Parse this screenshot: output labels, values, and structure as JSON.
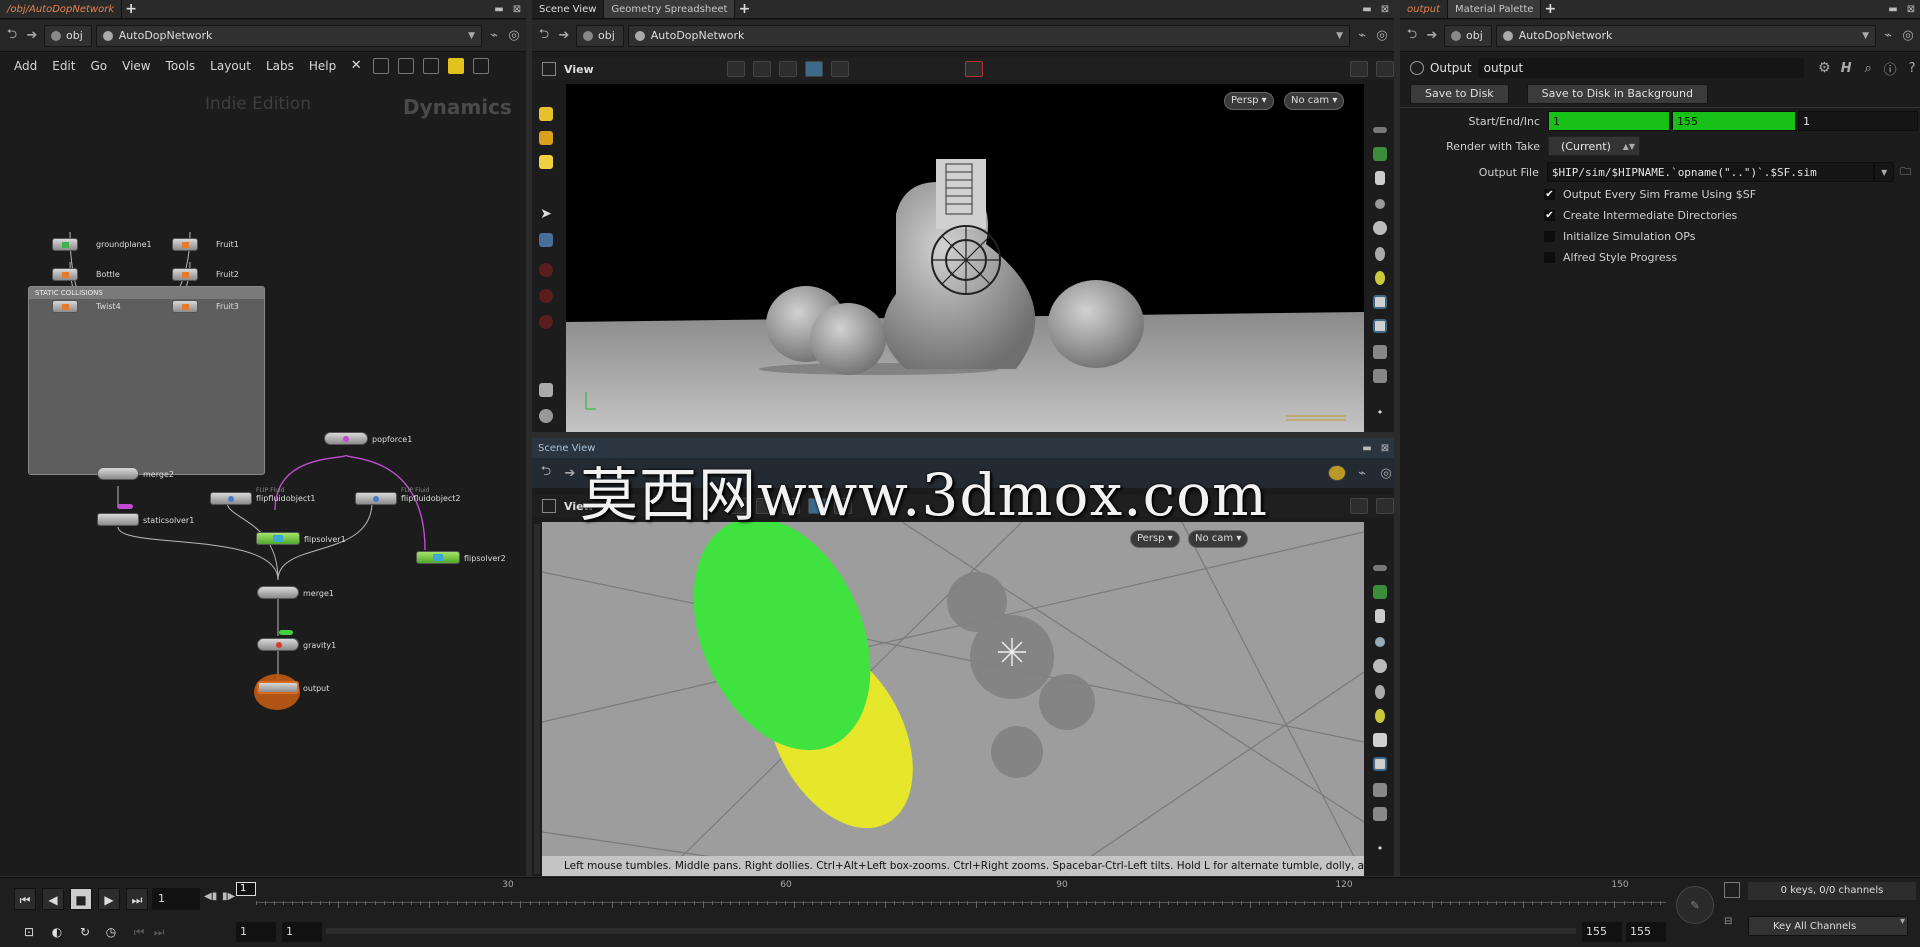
{
  "left": {
    "tab_path": "/obj/AutoDopNetwork",
    "path_obj": "obj",
    "path_net": "AutoDopNetwork",
    "menus": [
      "Add",
      "Edit",
      "Go",
      "View",
      "Tools",
      "Layout",
      "Labs",
      "Help"
    ],
    "edition": "Indie Edition",
    "context": "Dynamics",
    "netbox_title": "STATIC COLLISIONS",
    "nodes": {
      "groundplane1": "groundplane1",
      "bottle": "Bottle",
      "twist4": "Twist4",
      "fruit1": "Fruit1",
      "fruit2": "Fruit2",
      "fruit3": "Fruit3",
      "merge2": "merge2",
      "staticsolver1": "staticsolver1",
      "popforce1": "popforce1",
      "flipfluidobject1": "flipfluidobject1",
      "flipfluidobject2": "flipfluidobject2",
      "flip_fluid_sub": "FLIP Fluid",
      "flipsolver1": "flipsolver1",
      "flipsolver2": "flipsolver2",
      "merge1": "merge1",
      "gravity1": "gravity1",
      "output": "output"
    }
  },
  "middle": {
    "tabs": [
      "Scene View",
      "Geometry Spreadsheet"
    ],
    "path_obj": "obj",
    "path_net": "AutoDopNetwork",
    "view_label": "View",
    "persp": "Persp",
    "cam": "No cam",
    "lower_tab": "Scene View",
    "lower_view_label": "View",
    "lower_persp": "Persp",
    "lower_cam": "No cam",
    "status": "Left mouse tumbles. Middle pans. Right dollies. Ctrl+Alt+Left box-zooms. Ctrl+Right zooms. Spacebar-Ctrl-Left tilts. Hold L for alternate tumble, dolly, and zoom."
  },
  "right": {
    "tabs": [
      "output",
      "Material Palette"
    ],
    "path_obj": "obj",
    "path_net": "AutoDopNetwork",
    "node_type": "Output",
    "node_name": "output",
    "save_to_disk": "Save to Disk",
    "save_bg": "Save to Disk in Background",
    "start_end_label": "Start/End/Inc",
    "start": "1",
    "end": "155",
    "inc": "1",
    "render_take_label": "Render with Take",
    "render_take": "(Current)",
    "output_file_label": "Output File",
    "output_file": "$HIP/sim/$HIPNAME.`opname(\"..\")`.$SF.sim",
    "toggles": [
      {
        "label": "Output Every Sim Frame Using $SF",
        "checked": true
      },
      {
        "label": "Create Intermediate Directories",
        "checked": true
      },
      {
        "label": "Initialize Simulation OPs",
        "checked": false
      },
      {
        "label": "Alfred Style Progress",
        "checked": false
      }
    ]
  },
  "timeline": {
    "current_frame": "1",
    "frame_marker": "1",
    "ticks": [
      "30",
      "60",
      "90",
      "120",
      "150"
    ],
    "range_start": "1",
    "range_start2": "1",
    "range_end": "155",
    "range_end2": "155",
    "keys": "0 keys, 0/0 channels",
    "key_all": "Key All Channels"
  },
  "watermark": "莫西网www.3dmox.com",
  "colors": {
    "accent": "#e4814b",
    "green": "#18c018",
    "particle_green": "#3fe23f",
    "particle_yellow": "#e6e62a"
  }
}
